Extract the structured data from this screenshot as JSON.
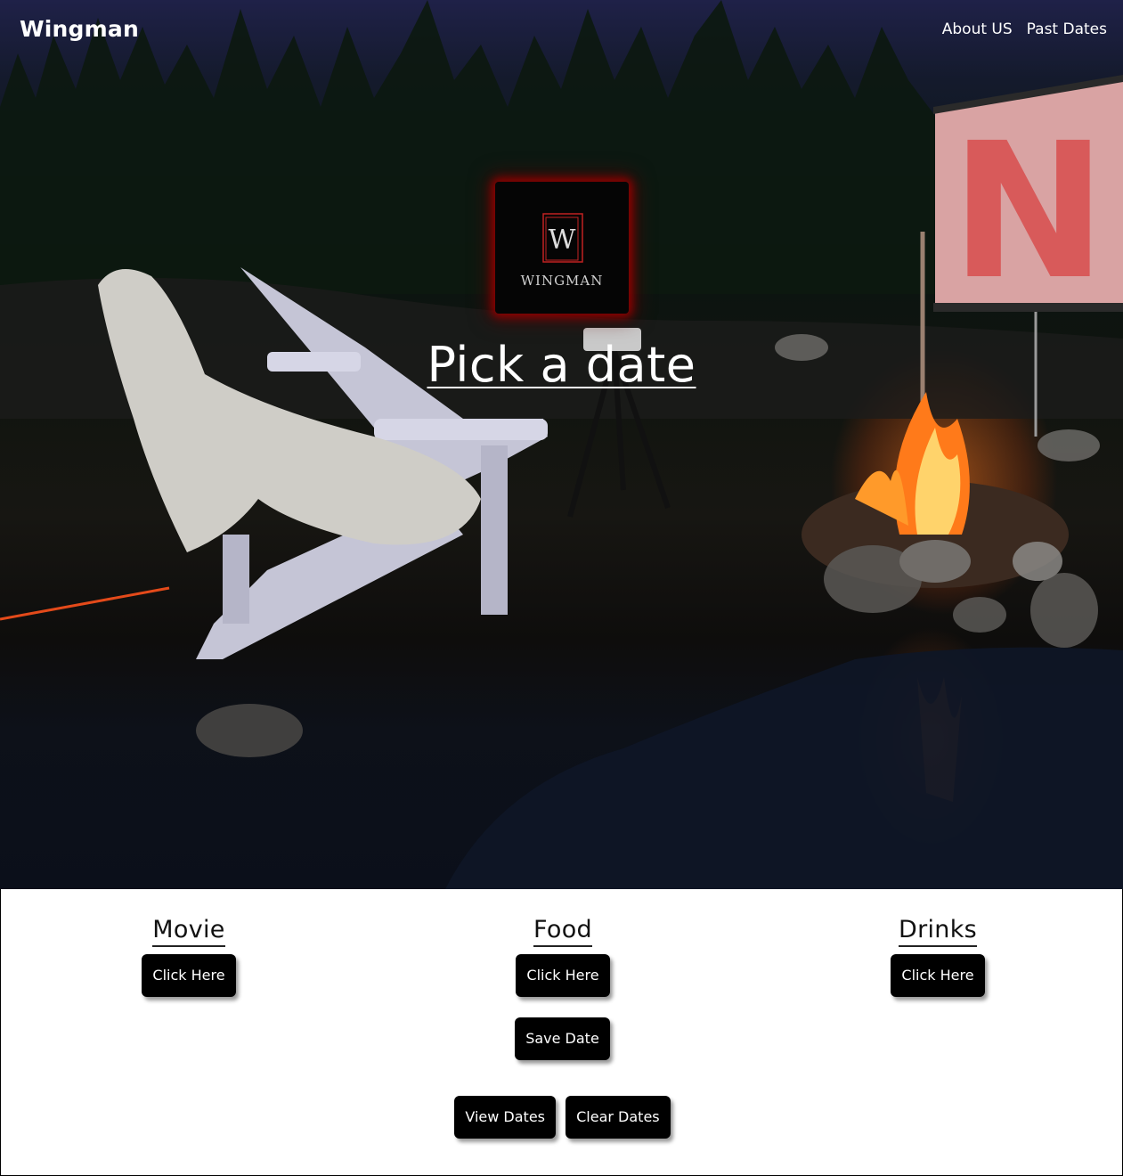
{
  "header": {
    "brand": "Wingman",
    "nav": [
      {
        "label": "About US"
      },
      {
        "label": "Past Dates"
      }
    ]
  },
  "hero": {
    "logo_text": "WINGMAN",
    "logo_letter": "W",
    "title": "Pick a date",
    "screen_letter": "N"
  },
  "categories": [
    {
      "title": "Movie",
      "button": "Click Here"
    },
    {
      "title": "Food",
      "button": "Click Here"
    },
    {
      "title": "Drinks",
      "button": "Click Here"
    }
  ],
  "actions": {
    "save": "Save Date",
    "view": "View Dates",
    "clear": "Clear Dates"
  },
  "colors": {
    "accent": "#e05555",
    "glow": "#960000",
    "button_bg": "#000000",
    "button_text": "#ffffff"
  }
}
